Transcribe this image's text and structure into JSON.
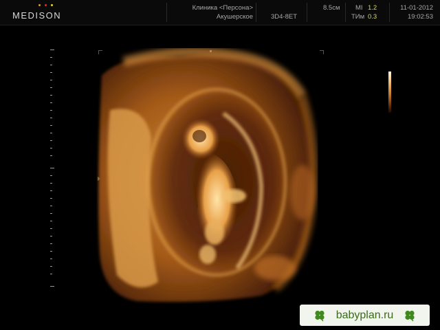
{
  "header": {
    "brand": "MEDISON",
    "brand_dot_colors": [
      "#e0a030",
      "#e03030",
      "#e0e030"
    ],
    "clinic_name": "Клиника <Персона>",
    "preset": "Акушерское",
    "probe": "3D4-8ET",
    "depth": "8.5см",
    "mi_label": "MI",
    "mi_value": "1.2",
    "tim_label": "ТИм",
    "tim_value": "0.3",
    "date": "11-01-2012",
    "time": "19:02:53"
  },
  "watermark": {
    "site": "babyplan.ru",
    "left_icon": "four-leaf-clover-icon",
    "right_icon": "four-leaf-clover-icon"
  },
  "colors": {
    "accent_value": "#d6d86a",
    "tissue_bright": "#f4c070",
    "tissue_mid": "#c47828",
    "tissue_dark": "#3a1804",
    "watermark_bg": "#f2f5ee",
    "watermark_text": "#3a6a1a"
  }
}
